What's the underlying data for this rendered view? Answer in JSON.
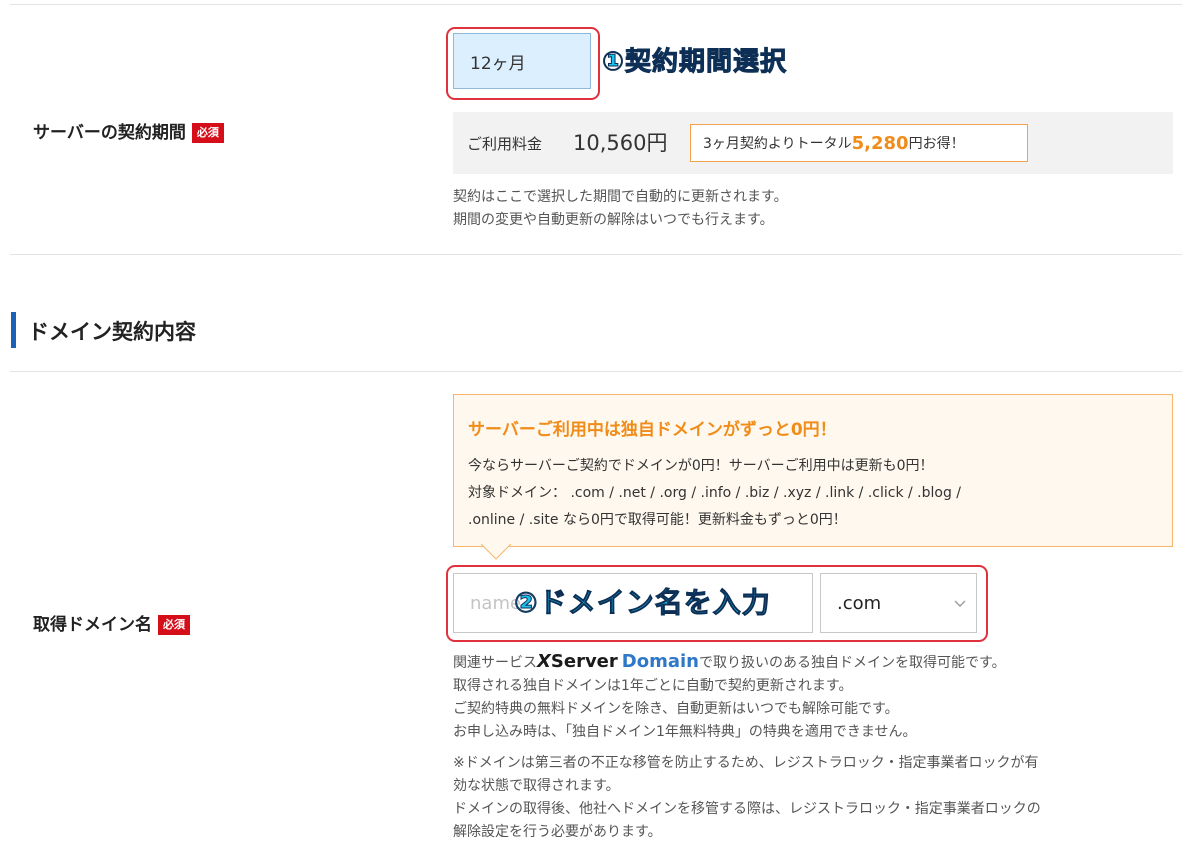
{
  "server": {
    "label": "サーバーの契約期間",
    "required_badge": "必須",
    "period_selected": "12ヶ月",
    "annotation": "①契約期間選択",
    "fee_label": "ご利用料金",
    "fee_value": "10,560円",
    "promo_before": "3ヶ月契約よりトータル",
    "promo_amount": "5,280",
    "promo_after": "円お得！",
    "note_line1": "契約はここで選択した期間で自動的に更新されます。",
    "note_line2": "期間の変更や自動更新の解除はいつでも行えます。"
  },
  "domain_section": {
    "heading": "ドメイン契約内容"
  },
  "domain": {
    "promo_title": "サーバーご利用中は独自ドメインがずっと0円！",
    "promo_line1": "今ならサーバーご契約でドメインが0円！サーバーご利用中は更新も0円！",
    "promo_line2": "対象ドメイン： .com / .net / .org / .info / .biz / .xyz / .link / .click / .blog /",
    "promo_line3": ".online / .site なら0円で取得可能！更新料金もずっと0円！",
    "label": "取得ドメイン名",
    "required_badge": "必須",
    "input_placeholder": "name",
    "annotation": "②ドメイン名を入力",
    "tld_selected": ".com",
    "related_prefix": "関連サービス",
    "related_brand_x": "X",
    "related_brand_server": "Server",
    "related_brand_domain": "Domain",
    "related_suffix": "で取り扱いのある独自ドメインを取得可能です。",
    "note_line2": "取得される独自ドメインは1年ごとに自動で契約更新されます。",
    "note_line3": "ご契約特典の無料ドメインを除き、自動更新はいつでも解除可能です。",
    "note_line4": "お申し込み時は、「独自ドメイン1年無料特典」の特典を適用できません。",
    "notice_line1": "※ドメインは第三者の不正な移管を防止するため、レジストラロック・指定事業者ロックが有",
    "notice_line2": "効な状態で取得されます。",
    "notice_line3": "ドメインの取得後、他社へドメインを移管する際は、レジストラロック・指定事業者ロックの",
    "notice_line4": "解除設定を行う必要があります。"
  },
  "colors": {
    "required_red": "#d60e1a",
    "annotation_cyan": "#1bc0f0",
    "highlight_red": "#e0323d",
    "promo_orange": "#f08c1a",
    "heading_bar_blue": "#1c61b5",
    "brand_blue": "#2f78c8"
  }
}
